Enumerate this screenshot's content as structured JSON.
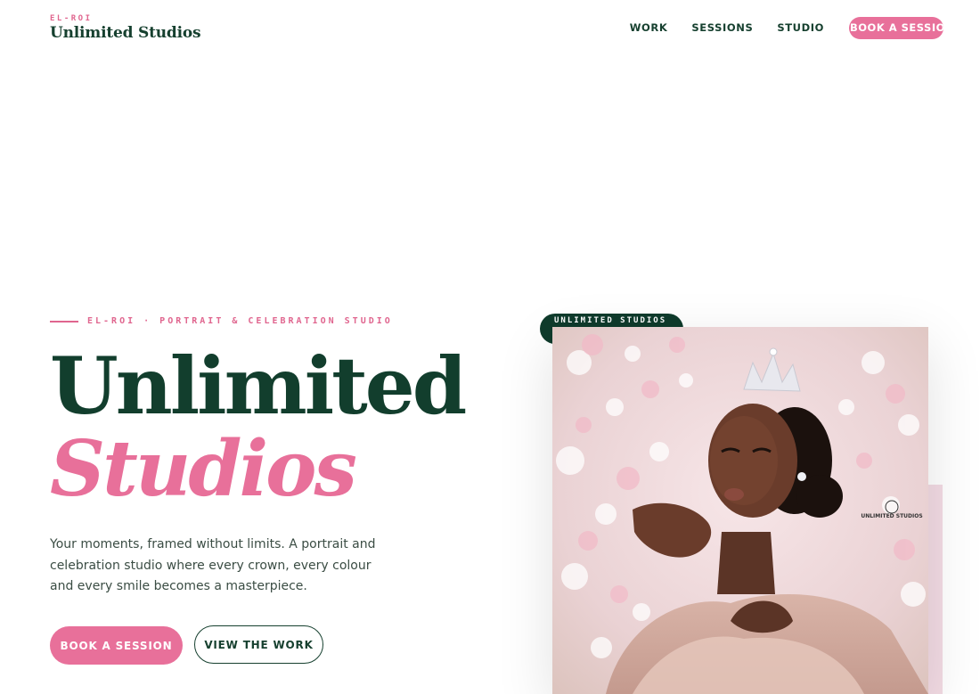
{
  "header": {
    "brand_kicker": "EL-ROI",
    "brand_name": "Unlimited Studios",
    "nav": [
      "WORK",
      "SESSIONS",
      "STUDIO"
    ],
    "cta": "BOOK A SESSION"
  },
  "hero": {
    "eyebrow": "EL-ROI · PORTRAIT & CELEBRATION STUDIO",
    "title_line1": "Unlimited",
    "title_line2": "Studios",
    "description": "Your moments, framed without limits. A portrait and celebration studio where every crown, every colour and every smile becomes a masterpiece.",
    "primary_button": "BOOK A SESSION",
    "secondary_button": "VIEW THE WORK",
    "image_chip": "UNLIMITED STUDIOS",
    "image_watermark": "UNLIMITED STUDIOS"
  },
  "colors": {
    "primary_green": "#123e2d",
    "accent_pink": "#e8709a",
    "text_body": "#3b4d44"
  }
}
